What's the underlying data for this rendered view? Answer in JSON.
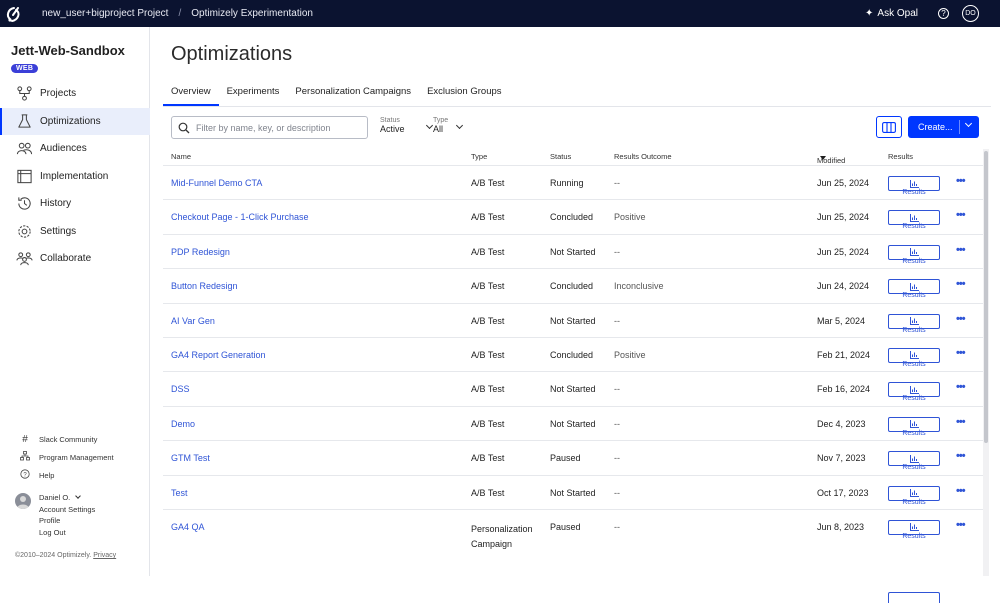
{
  "topbar": {
    "project": "new_user+bigproject Project",
    "product": "Optimizely Experimentation",
    "ask_opal": "Ask Opal",
    "help": "?",
    "user_initials": "DO"
  },
  "sidebar": {
    "project_name": "Jett-Web-Sandbox",
    "badge": "WEB",
    "items": [
      {
        "label": "Projects",
        "icon": "projects-icon"
      },
      {
        "label": "Optimizations",
        "icon": "flask-icon",
        "active": true
      },
      {
        "label": "Audiences",
        "icon": "audiences-icon"
      },
      {
        "label": "Implementation",
        "icon": "implementation-icon"
      },
      {
        "label": "History",
        "icon": "history-icon"
      },
      {
        "label": "Settings",
        "icon": "gear-icon"
      },
      {
        "label": "Collaborate",
        "icon": "collaborate-icon"
      }
    ],
    "links": [
      {
        "label": "Slack Community",
        "icon": "hash-icon"
      },
      {
        "label": "Program Management",
        "icon": "hierarchy-icon"
      },
      {
        "label": "Help",
        "icon": "help-icon"
      }
    ],
    "user": {
      "name": "Daniel O.",
      "account_settings": "Account Settings",
      "profile": "Profile",
      "logout": "Log Out"
    },
    "copyright": "©2010–2024 Optimizely.",
    "privacy": "Privacy"
  },
  "main": {
    "title": "Optimizations",
    "tabs": [
      {
        "label": "Overview",
        "active": true
      },
      {
        "label": "Experiments"
      },
      {
        "label": "Personalization Campaigns"
      },
      {
        "label": "Exclusion Groups"
      }
    ],
    "search_placeholder": "Filter by name, key, or description",
    "status_filter": {
      "label": "Status",
      "value": "Active"
    },
    "type_filter": {
      "label": "Type",
      "value": "All"
    },
    "create_label": "Create...",
    "columns": {
      "name": "Name",
      "type": "Type",
      "status": "Status",
      "outcome": "Results Outcome",
      "modified": "Modified",
      "results": "Results"
    },
    "results_label": "Results",
    "more_label": "•••",
    "rows": [
      {
        "name": "Mid-Funnel Demo CTA",
        "type": "A/B Test",
        "status": "Running",
        "outcome": "--",
        "modified": "Jun 25, 2024"
      },
      {
        "name": "Checkout Page - 1-Click Purchase",
        "type": "A/B Test",
        "status": "Concluded",
        "outcome": "Positive",
        "modified": "Jun 25, 2024"
      },
      {
        "name": "PDP Redesign",
        "type": "A/B Test",
        "status": "Not Started",
        "outcome": "--",
        "modified": "Jun 25, 2024"
      },
      {
        "name": "Button Redesign",
        "type": "A/B Test",
        "status": "Concluded",
        "outcome": "Inconclusive",
        "modified": "Jun 24, 2024"
      },
      {
        "name": "AI Var Gen",
        "type": "A/B Test",
        "status": "Not Started",
        "outcome": "--",
        "modified": "Mar 5, 2024"
      },
      {
        "name": "GA4 Report Generation",
        "type": "A/B Test",
        "status": "Concluded",
        "outcome": "Positive",
        "modified": "Feb 21, 2024"
      },
      {
        "name": "DSS",
        "type": "A/B Test",
        "status": "Not Started",
        "outcome": "--",
        "modified": "Feb 16, 2024"
      },
      {
        "name": "Demo",
        "type": "A/B Test",
        "status": "Not Started",
        "outcome": "--",
        "modified": "Dec 4, 2023"
      },
      {
        "name": "GTM Test",
        "type": "A/B Test",
        "status": "Paused",
        "outcome": "--",
        "modified": "Nov 7, 2023"
      },
      {
        "name": "Test",
        "type": "A/B Test",
        "status": "Not Started",
        "outcome": "--",
        "modified": "Oct 17, 2023"
      },
      {
        "name": "GA4 QA",
        "type": "Personalization Campaign",
        "status": "Paused",
        "outcome": "--",
        "modified": "Jun 8, 2023"
      }
    ]
  },
  "colors": {
    "topbar": "#0b1330",
    "accent": "#0037ff",
    "link": "#2f54d6",
    "badge": "#3b3fd8"
  }
}
